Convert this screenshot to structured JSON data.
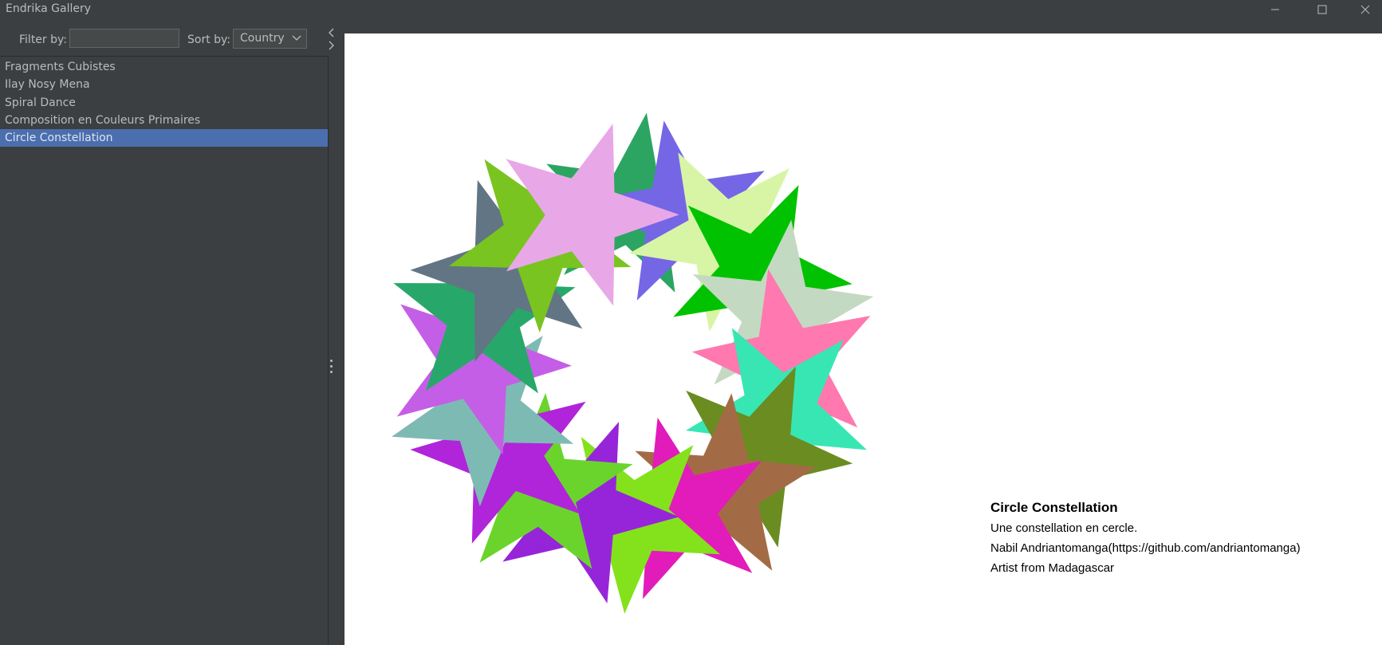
{
  "window": {
    "title": "Endrika Gallery",
    "controls": [
      "minimize-icon",
      "maximize-icon",
      "close-icon"
    ]
  },
  "toolbar": {
    "filter_label": "Filter by:",
    "filter_value": "",
    "sort_label": "Sort by:",
    "sort_value": "Country"
  },
  "gallery": {
    "items": [
      {
        "label": "Fragments Cubistes",
        "selected": false
      },
      {
        "label": "Ilay Nosy Mena",
        "selected": false
      },
      {
        "label": "Spiral Dance",
        "selected": false
      },
      {
        "label": "Composition en Couleurs Primaires",
        "selected": false
      },
      {
        "label": "Circle Constellation",
        "selected": true
      }
    ]
  },
  "artwork": {
    "title": "Circle Constellation",
    "description": "Une constellation en cercle.",
    "author": "Nabil Andriantomanga(https://github.com/andriantomanga)",
    "origin": "Artist from Madagascar",
    "star_colors": [
      "#2ca562",
      "#7566e6",
      "#d8f5a6",
      "#00c200",
      "#c4d9c2",
      "#ff78b0",
      "#38e6b4",
      "#6a8c21",
      "#a36b45",
      "#e21bbb",
      "#84e21c",
      "#9625d9",
      "#6ad42c",
      "#b025da",
      "#7ebab4",
      "#c55ee6",
      "#27a86a",
      "#627584",
      "#7ac421",
      "#e8a8e8"
    ]
  },
  "colors": {
    "window_bg": "#3c3f41",
    "selection": "#4b6eaf",
    "canvas_bg": "#ffffff",
    "text": "#bbbbbb"
  }
}
